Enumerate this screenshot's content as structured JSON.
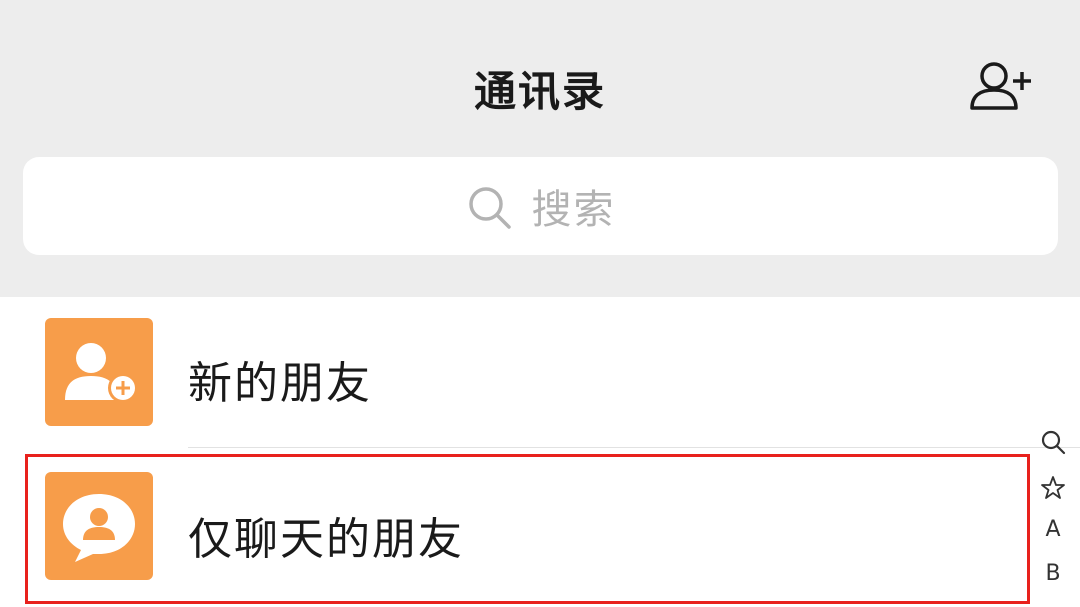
{
  "header": {
    "title": "通讯录",
    "add_contact_icon": "add-contact-icon"
  },
  "search": {
    "placeholder": "搜索",
    "icon": "search-icon"
  },
  "list": {
    "items": [
      {
        "label": "新的朋友",
        "icon": "new-friend-icon",
        "color": "#f79d4a"
      },
      {
        "label": "仅聊天的朋友",
        "icon": "chat-only-friend-icon",
        "color": "#f79d4a"
      }
    ]
  },
  "index_bar": {
    "items": [
      "search-icon",
      "star-icon",
      "A",
      "B"
    ]
  },
  "colors": {
    "accent": "#f79d4a",
    "highlight": "#e8211d",
    "header_bg": "#ededed"
  }
}
